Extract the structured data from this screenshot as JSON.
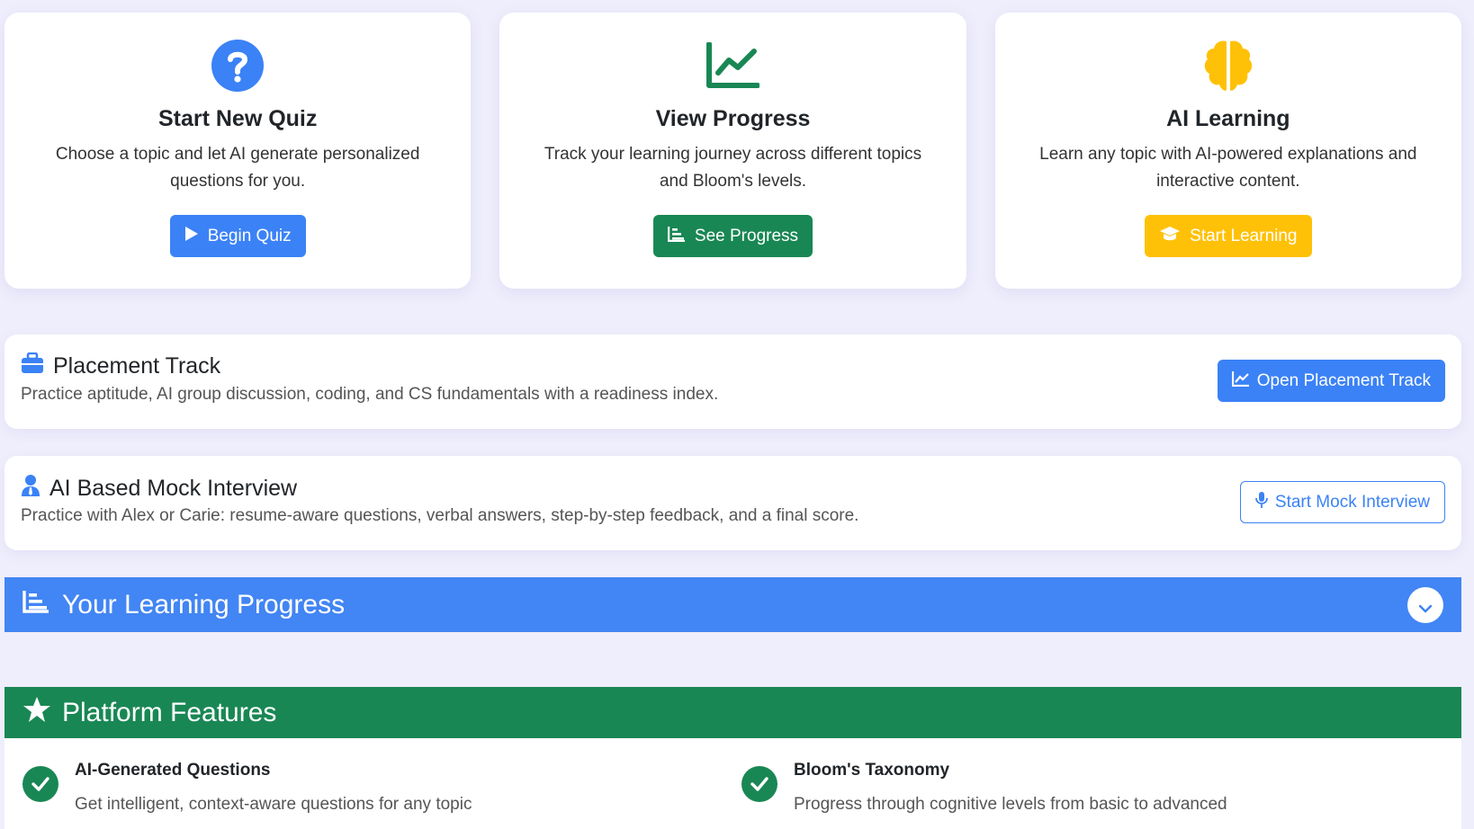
{
  "cards": [
    {
      "title": "Start New Quiz",
      "desc": "Choose a topic and let AI generate personalized questions for you.",
      "button": "Begin Quiz"
    },
    {
      "title": "View Progress",
      "desc": "Track your learning journey across different topics and Bloom's levels.",
      "button": "See Progress"
    },
    {
      "title": "AI Learning",
      "desc": "Learn any topic with AI-powered explanations and interactive content.",
      "button": "Start Learning"
    }
  ],
  "placement": {
    "title": "Placement Track",
    "desc": "Practice aptitude, AI group discussion, coding, and CS fundamentals with a readiness index.",
    "button": "Open Placement Track"
  },
  "mock": {
    "title": "AI Based Mock Interview",
    "desc": "Practice with Alex or Carie: resume-aware questions, verbal answers, step-by-step feedback, and a final score.",
    "button": "Start Mock Interview"
  },
  "progress": {
    "title": "Your Learning Progress"
  },
  "features": {
    "title": "Platform Features",
    "items": [
      {
        "title": "AI-Generated Questions",
        "desc": "Get intelligent, context-aware questions for any topic"
      },
      {
        "title": "Bloom's Taxonomy",
        "desc": "Progress through cognitive levels from basic to advanced"
      }
    ]
  },
  "colors": {
    "background": "#efeefc",
    "blue": "#3b82f6",
    "green": "#198754",
    "yellow": "#ffc107",
    "progress_header": "#4285f4"
  },
  "icons": {
    "quiz": "question-circle-icon",
    "progress": "line-chart-icon",
    "learning": "brain-icon",
    "placement": "briefcase-icon",
    "mock": "person-tie-icon",
    "features": "star-icon"
  }
}
